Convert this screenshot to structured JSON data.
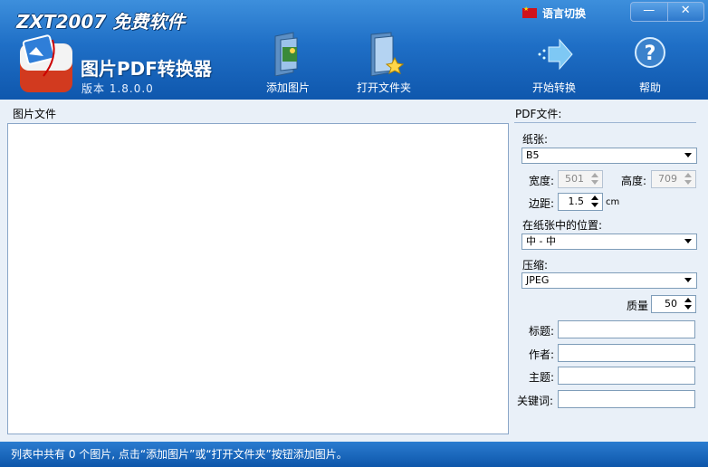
{
  "header": {
    "brand": "ZXT2007 免费软件",
    "app_title": "图片PDF转换器",
    "version": "版本 1.8.0.0",
    "language_label": "语言切换",
    "minimize": "—",
    "close": "✕"
  },
  "toolbar": {
    "add_image": "添加图片",
    "open_folder": "打开文件夹",
    "start_convert": "开始转换",
    "help": "帮助"
  },
  "left": {
    "label": "图片文件"
  },
  "pdf": {
    "section_title": "PDF文件:",
    "paper_label": "纸张:",
    "paper_value": "B5",
    "width_label": "宽度:",
    "width_value": "501",
    "height_label": "高度:",
    "height_value": "709",
    "margin_label": "边距:",
    "margin_value": "1.5",
    "margin_unit": "cm",
    "position_label": "在纸张中的位置:",
    "position_value": "中 - 中",
    "compress_label": "压缩:",
    "compress_value": "JPEG",
    "quality_label": "质量",
    "quality_value": "50",
    "title_label": "标题:",
    "author_label": "作者:",
    "subject_label": "主题:",
    "keywords_label": "关键词:"
  },
  "status": {
    "text": "列表中共有 0 个图片, 点击“添加图片”或“打开文件夹”按钮添加图片。"
  },
  "colors": {
    "header_top": "#3d8fdc",
    "header_bottom": "#0f57ad",
    "panel_bg": "#e9f0f8"
  }
}
